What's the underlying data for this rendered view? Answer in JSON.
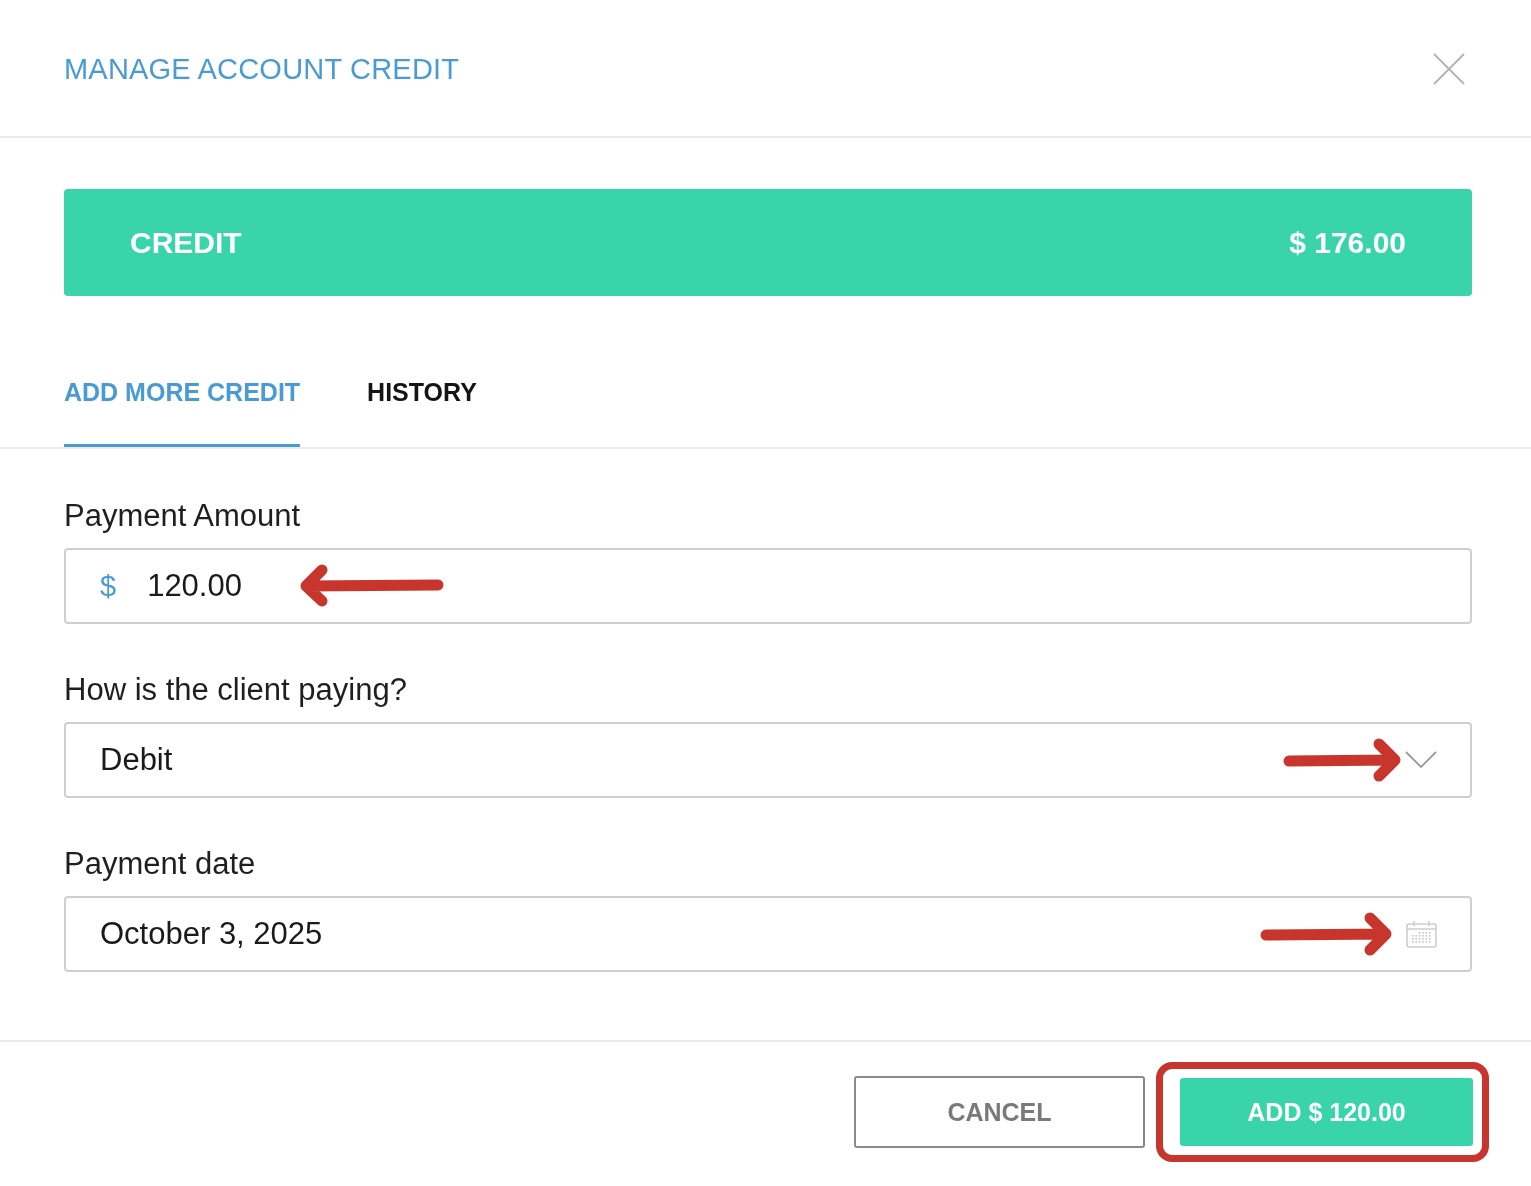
{
  "dialog": {
    "title": "MANAGE ACCOUNT CREDIT"
  },
  "credit_banner": {
    "label": "CREDIT",
    "amount": "$ 176.00"
  },
  "tabs": [
    {
      "label": "ADD MORE CREDIT",
      "selected": true
    },
    {
      "label": "HISTORY",
      "selected": false
    }
  ],
  "fields": [
    {
      "kind": "amount",
      "label": "Payment Amount",
      "prefix": "$",
      "value": "120.00",
      "annotation": {
        "kind": "arrow_left"
      }
    },
    {
      "kind": "select",
      "label": "How is the client paying?",
      "value": "Debit",
      "annotation": {
        "kind": "arrow_right"
      }
    },
    {
      "kind": "date",
      "label": "Payment date",
      "value": "October 3, 2025",
      "annotation": {
        "kind": "arrow_right"
      }
    }
  ],
  "buttons": [
    {
      "kind": "secondary",
      "label": "CANCEL",
      "highlighted": false
    },
    {
      "kind": "primary",
      "label": "ADD $ 120.00",
      "highlighted": true
    }
  ]
}
